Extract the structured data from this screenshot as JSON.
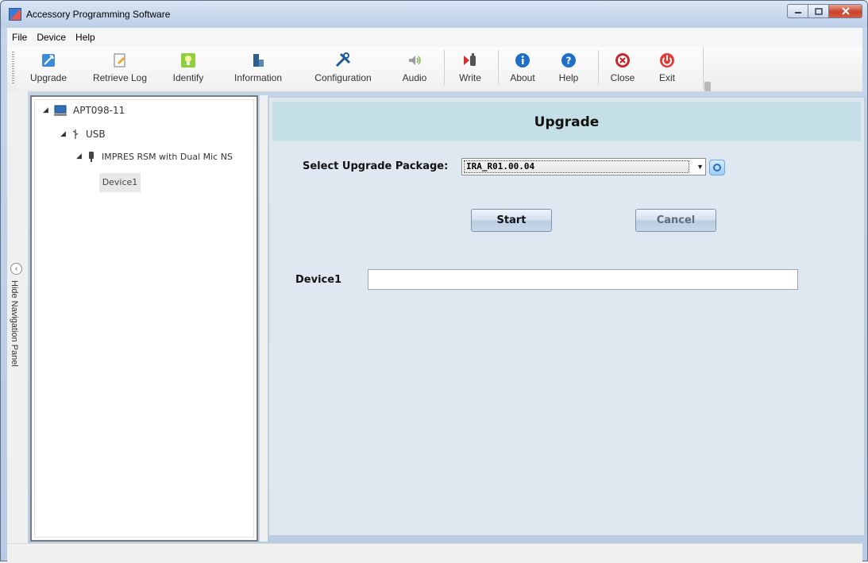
{
  "window": {
    "title": "Accessory Programming Software"
  },
  "menu": [
    {
      "label": "File"
    },
    {
      "label": "Device"
    },
    {
      "label": "Help"
    }
  ],
  "toolbar": [
    {
      "label": "Upgrade",
      "icon": "upgrade-icon"
    },
    {
      "label": "Retrieve Log",
      "icon": "retrieve-log-icon"
    },
    {
      "label": "Identify",
      "icon": "identify-icon"
    },
    {
      "label": "Information",
      "icon": "information-icon"
    },
    {
      "label": "Configuration",
      "icon": "configuration-icon"
    },
    {
      "label": "Audio",
      "icon": "audio-icon"
    },
    {
      "label": "Write",
      "icon": "write-icon"
    },
    {
      "label": "About",
      "icon": "about-icon"
    },
    {
      "label": "Help",
      "icon": "help-icon"
    },
    {
      "label": "Close",
      "icon": "close-icon"
    },
    {
      "label": "Exit",
      "icon": "exit-icon"
    }
  ],
  "nav": {
    "hide_label": "Hide Navigation Panel"
  },
  "tree": {
    "root": "APT098-11",
    "usb": "USB",
    "device_model": "IMPRES RSM with Dual Mic NS",
    "device": "Device1"
  },
  "upgrade": {
    "title": "Upgrade",
    "select_label": "Select Upgrade Package:",
    "selected_package": "IRA_R01.00.04",
    "start_label": "Start",
    "cancel_label": "Cancel",
    "device_label": "Device1",
    "device_progress": ""
  },
  "colors": {
    "header_bg": "#c4e0e6",
    "panel_bg": "#dfe8f1",
    "close_red": "#c8422c"
  }
}
